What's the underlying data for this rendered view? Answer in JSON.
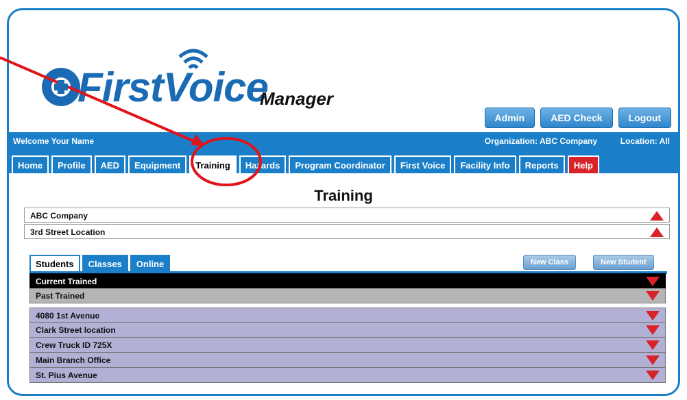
{
  "brand": {
    "name": "FirstVoice",
    "suffix": "Manager"
  },
  "top_buttons": [
    "Admin",
    "AED Check",
    "Logout"
  ],
  "welcome": {
    "left": "Welcome Your Name",
    "organization": "Organization: ABC Company",
    "location": "Location: All"
  },
  "nav_tabs": [
    "Home",
    "Profile",
    "AED",
    "Equipment",
    "Training",
    "Hazards",
    "Program Coordinator",
    "First Voice",
    "Facility Info",
    "Reports",
    "Help"
  ],
  "active_tab": "Training",
  "page_title": "Training",
  "company": "ABC Company",
  "location": "3rd Street Location",
  "sub_tabs": [
    "Students",
    "Classes",
    "Online"
  ],
  "action_buttons": [
    "New Class",
    "New Student"
  ],
  "trained_rows": [
    "Current Trained",
    "Past Trained"
  ],
  "locations": [
    "4080 1st Avenue",
    "Clark Street location",
    "Crew Truck ID 725X",
    "Main Branch Office",
    "St. Pius Avenue"
  ],
  "colors": {
    "primary": "#1a7fc8",
    "help": "#d8232a",
    "annotation": "#e0141a",
    "row_lavender": "#b3b0d6"
  }
}
